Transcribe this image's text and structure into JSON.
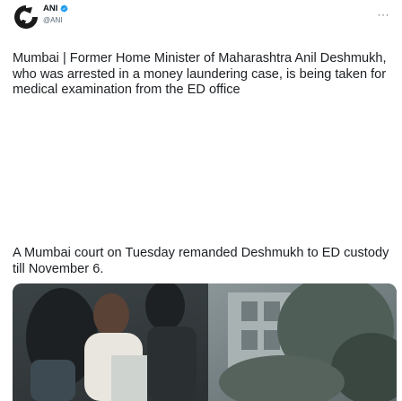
{
  "author": {
    "display_name": "ANI",
    "handle": "@ANI",
    "avatar_icon": "ani-logo-icon",
    "verified_icon": "verified-badge-icon",
    "verified_color": "#1d9bf0"
  },
  "menu": {
    "more_label": "···",
    "more_icon": "more-options-icon"
  },
  "tweet": {
    "paragraph_1": "Mumbai | Former Home Minister of Maharashtra Anil Deshmukh, who was arrested in a money laundering case, is being taken for medical examination from the ED office",
    "paragraph_2": "A Mumbai court on Tuesday remanded Deshmukh to ED custody till November 6."
  },
  "colors": {
    "text": "#1b1f23",
    "secondary": "#536471"
  }
}
